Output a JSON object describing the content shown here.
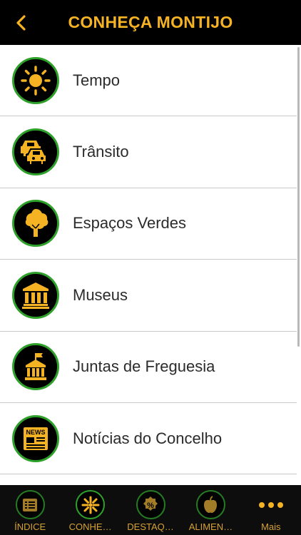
{
  "header": {
    "title": "CONHEÇA MONTIJO"
  },
  "items": [
    {
      "label": "Tempo"
    },
    {
      "label": "Trânsito"
    },
    {
      "label": "Espaços Verdes"
    },
    {
      "label": "Museus"
    },
    {
      "label": "Juntas de Freguesia"
    },
    {
      "label": "Notícias do Concelho"
    }
  ],
  "tabs": [
    {
      "label": "ÍNDICE"
    },
    {
      "label": "CONHE…"
    },
    {
      "label": "DESTAQ…"
    },
    {
      "label": "ALIMEN…"
    },
    {
      "label": "Mais"
    }
  ],
  "icons": {
    "items": [
      "sun-icon",
      "cars-icon",
      "tree-icon",
      "museum-icon",
      "town-hall-icon",
      "news-icon"
    ],
    "tabs": [
      "index-list-icon",
      "flower-icon",
      "discount-icon",
      "apple-icon",
      "more-dots-icon"
    ]
  },
  "colors": {
    "accent": "#f5b324",
    "ring": "#2ea12a",
    "header_bg": "#000000"
  }
}
